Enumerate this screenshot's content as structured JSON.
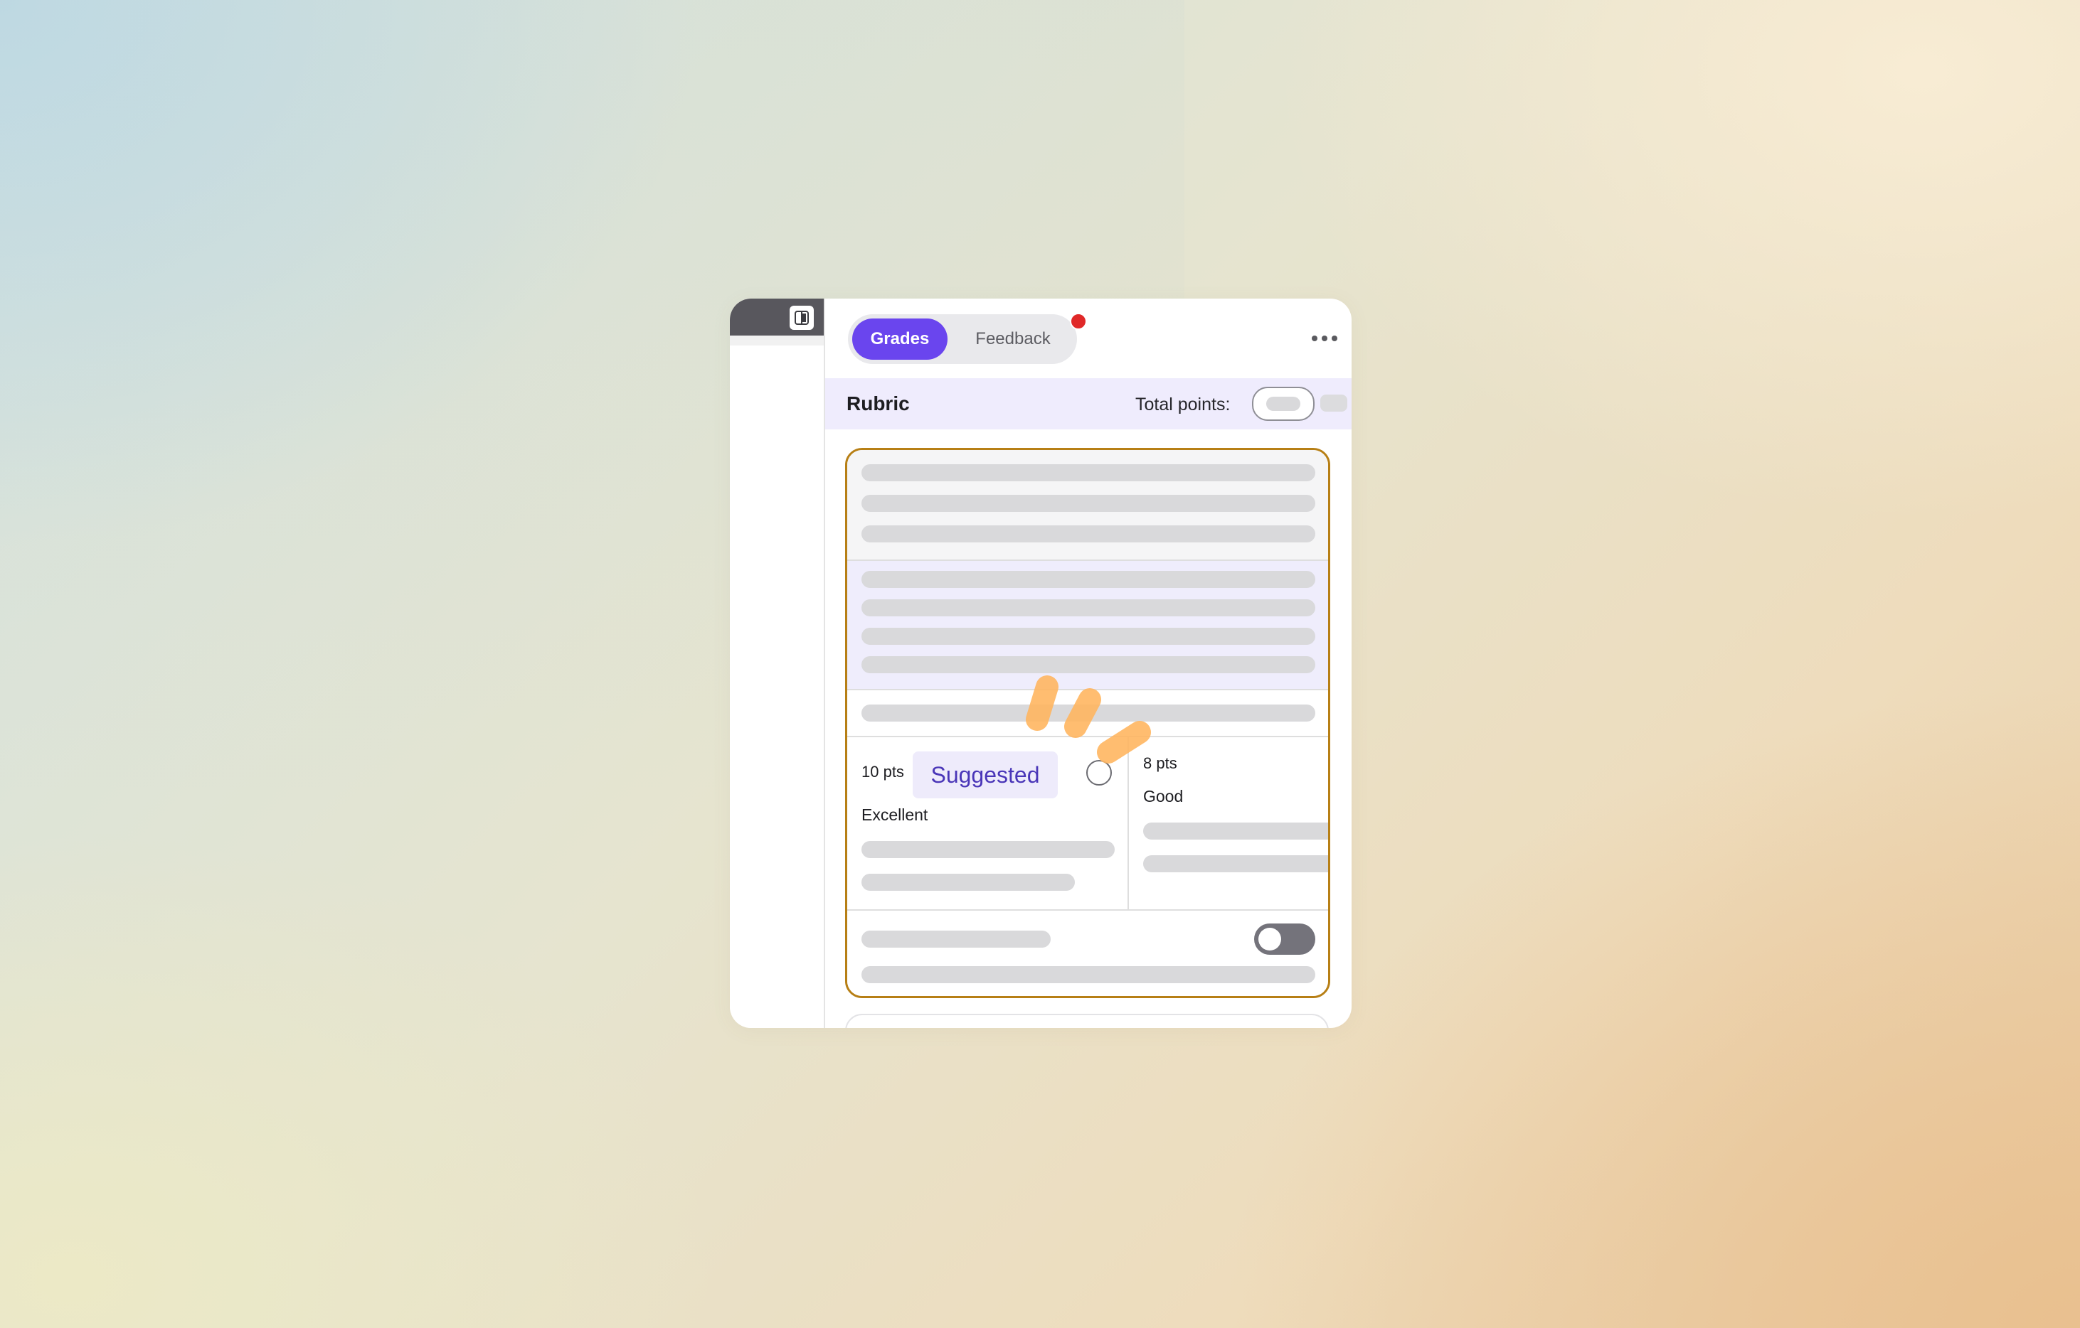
{
  "sidebar": {
    "panel_toggle_icon": "sidebar-panel-icon"
  },
  "tabs": {
    "items": [
      {
        "label": "Grades",
        "active": true
      },
      {
        "label": "Feedback",
        "active": false
      }
    ],
    "notification_dot_color": "#e02828",
    "more_icon": "more-horizontal-icon"
  },
  "rubric": {
    "title": "Rubric",
    "total_points_label": "Total points:"
  },
  "criterion": {
    "ratings": [
      {
        "points": "10 pts",
        "name": "Excellent",
        "badge": "Suggested",
        "selected": false
      },
      {
        "points": "8 pts",
        "name": "Good"
      }
    ],
    "toggle_on": false
  },
  "colors": {
    "accent": "#6a45ee",
    "criterion_border": "#b77f15",
    "suggested_text": "#4a36b8",
    "sparkle": "#ffb661"
  }
}
